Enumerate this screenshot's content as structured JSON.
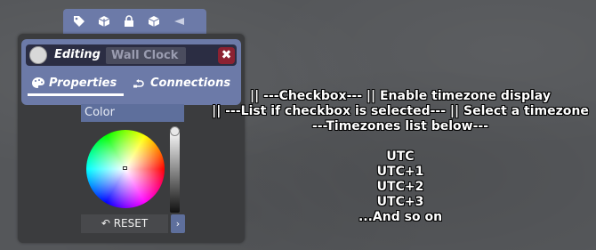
{
  "toolbar": {
    "icons": [
      "tag-icon",
      "package-icon",
      "lock-icon",
      "cube-icon",
      "collapse-arrow-icon"
    ]
  },
  "panel": {
    "editing_label": "Editing",
    "object_name": "Wall Clock",
    "close_label": "✖",
    "tabs": [
      {
        "label": "Properties",
        "active": true
      },
      {
        "label": "Connections",
        "active": false
      }
    ]
  },
  "color": {
    "header": "Color",
    "reset_label": "RESET",
    "next_label": "›"
  },
  "overlay": {
    "lines": [
      "|| ---Checkbox--- || Enable timezone display",
      "|| ---List if checkbox is selected--- || Select a timezone",
      "---Timezones list below---",
      "",
      "UTC",
      "UTC+1",
      "UTC+2",
      "UTC+3",
      "...And so on"
    ]
  },
  "colors": {
    "accent": "#6c7aa8",
    "panel_bg": "#3b3c3e",
    "title_bar": "#2b2d43",
    "close_button": "#8c2232"
  }
}
